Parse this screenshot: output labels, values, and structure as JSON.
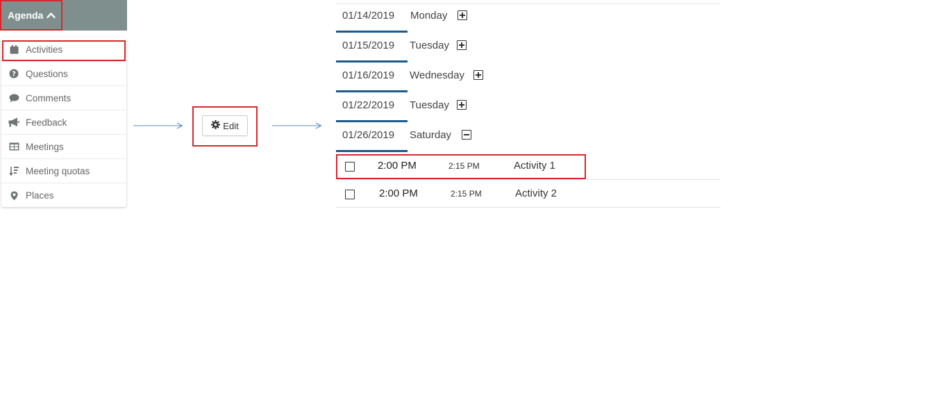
{
  "colors": {
    "header_bg": "#7f8f8e",
    "highlight": "#d9262c",
    "tab_underline": "#1a5a8c",
    "arrow": "#5b8db8"
  },
  "menu": {
    "toggle_label": "Agenda",
    "toggle_icon": "chevron-up-icon",
    "items": [
      {
        "label": "Activities",
        "icon": "calendar-icon"
      },
      {
        "label": "Questions",
        "icon": "question-circle-icon"
      },
      {
        "label": "Comments",
        "icon": "comment-icon"
      },
      {
        "label": "Feedback",
        "icon": "megaphone-icon"
      },
      {
        "label": "Meetings",
        "icon": "table-icon"
      },
      {
        "label": "Meeting quotas",
        "icon": "sort-amount-icon"
      },
      {
        "label": "Places",
        "icon": "map-marker-icon"
      }
    ]
  },
  "edit_button": {
    "label": "Edit",
    "icon": "gear-icon"
  },
  "agenda": {
    "dates": [
      {
        "date": "01/14/2019",
        "day": "Monday",
        "expanded": false
      },
      {
        "date": "01/15/2019",
        "day": "Tuesday",
        "expanded": false
      },
      {
        "date": "01/16/2019",
        "day": "Wednesday",
        "expanded": false
      },
      {
        "date": "01/22/2019",
        "day": "Tuesday",
        "expanded": false
      },
      {
        "date": "01/26/2019",
        "day": "Saturday",
        "expanded": true
      }
    ],
    "activities": [
      {
        "start": "2:00 PM",
        "end": "2:15 PM",
        "name": "Activity 1",
        "checked": false
      },
      {
        "start": "2:00 PM",
        "end": "2:15 PM",
        "name": "Activity 2",
        "checked": false
      }
    ]
  }
}
